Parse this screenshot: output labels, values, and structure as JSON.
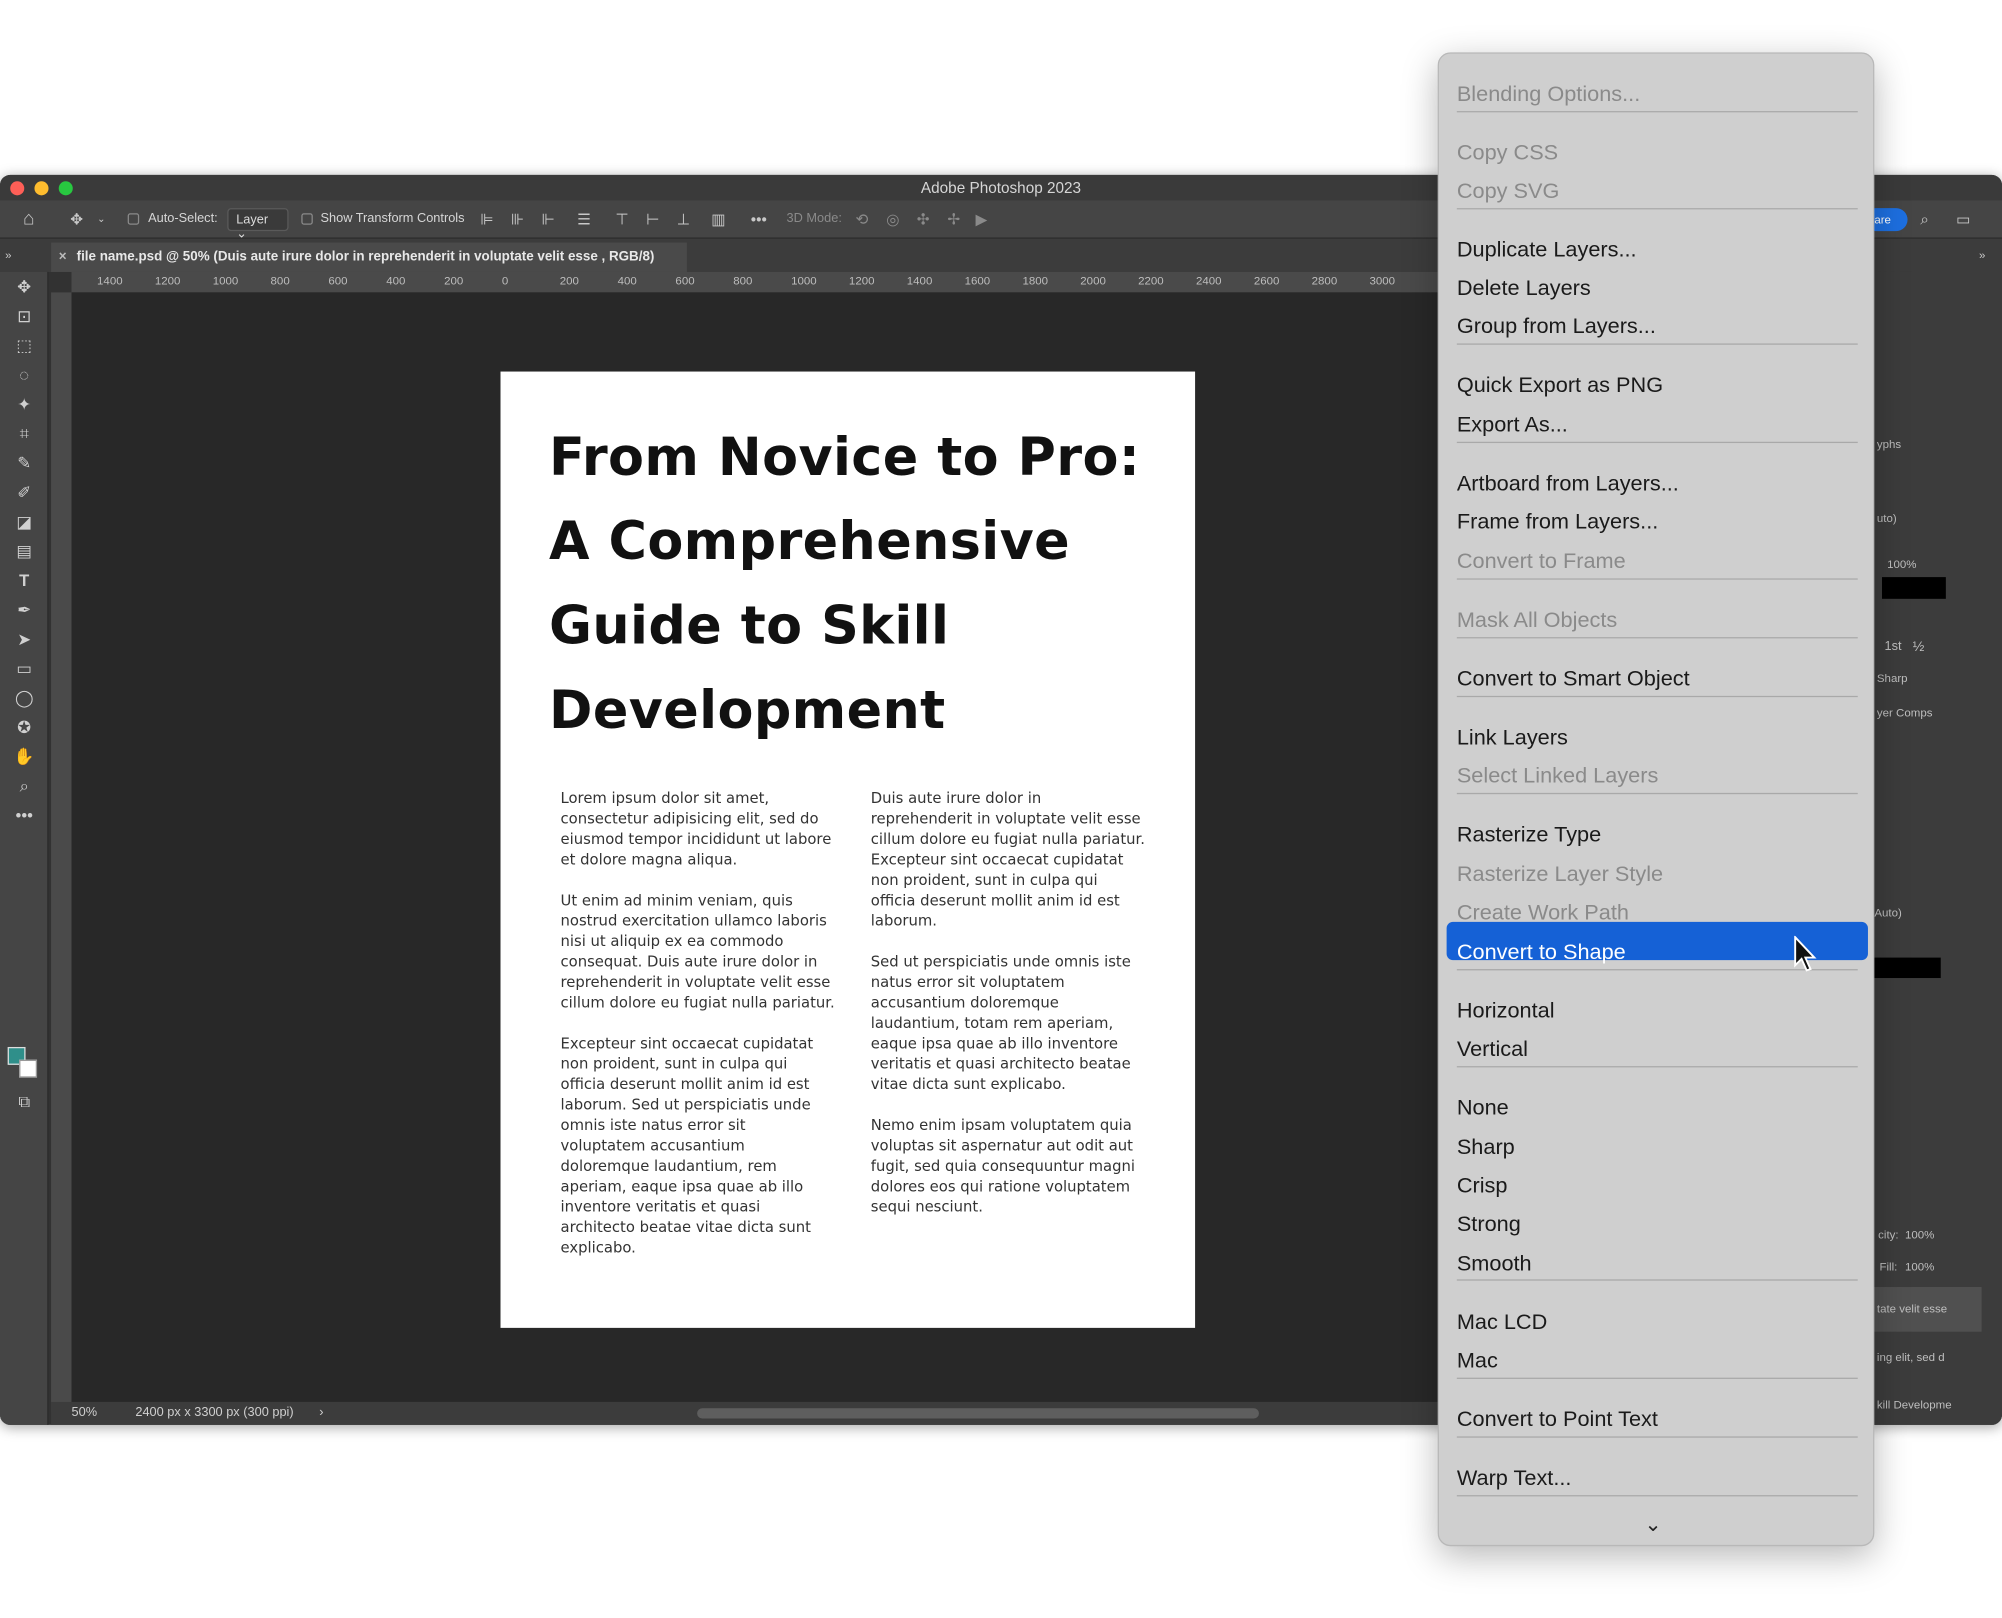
{
  "window": {
    "title": "Adobe Photoshop 2023",
    "traffic_colors": [
      "#fe5f57",
      "#febc2e",
      "#28c840"
    ]
  },
  "options_bar": {
    "auto_select_label": "Auto-Select:",
    "auto_select_value": "Layer",
    "show_transform_label": "Show Transform Controls",
    "mode_label": "3D Mode:",
    "share_label": "are"
  },
  "document_tab": {
    "title": "file name.psd @ 50% (Duis aute irure dolor in reprehenderit in voluptate velit esse , RGB/8)"
  },
  "ruler": {
    "ticks": [
      "1400",
      "1200",
      "1000",
      "800",
      "600",
      "400",
      "200",
      "0",
      "200",
      "400",
      "600",
      "800",
      "1000",
      "1200",
      "1400",
      "1600",
      "1800",
      "2000",
      "2200",
      "2400",
      "2600",
      "2800",
      "3000"
    ]
  },
  "status_bar": {
    "zoom": "50%",
    "dimensions": "2400 px x 3300 px (300 ppi)"
  },
  "document": {
    "title_lines": [
      "From Novice to Pro:",
      "A Comprehensive",
      "Guide to Skill",
      "Development"
    ],
    "left_paragraphs": [
      "Lorem ipsum dolor sit amet, consectetur adipisicing elit, sed do eiusmod tempor incididunt ut labore et dolore magna aliqua.",
      "Ut enim ad minim veniam, quis nostrud exercitation ullamco laboris nisi ut aliquip ex ea commodo consequat. Duis aute irure dolor in reprehenderit in voluptate velit esse cillum dolore eu fugiat nulla pariatur.",
      "Excepteur sint occaecat cupidatat non proident, sunt in culpa qui officia deserunt mollit anim id est laborum. Sed ut perspiciatis unde omnis iste natus error sit voluptatem accusantium doloremque laudantium, rem aperiam, eaque ipsa quae ab illo inventore veritatis et quasi architecto beatae vitae dicta sunt explicabo."
    ],
    "right_paragraphs": [
      "Duis aute irure dolor in reprehenderit in voluptate velit esse cillum dolore eu fugiat nulla pariatur. Excepteur sint occaecat cupidatat non proident, sunt in culpa qui officia deserunt mollit anim id est laborum.",
      "Sed ut perspiciatis unde omnis iste natus error sit voluptatem accusantium doloremque laudantium, totam rem aperiam, eaque ipsa quae ab illo inventore veritatis et quasi architecto beatae vitae dicta sunt explicabo.",
      "Nemo enim ipsam voluptatem quia voluptas sit aspernatur aut odit aut fugit, sed quia consequuntur magni dolores eos qui ratione voluptatem sequi nesciunt."
    ]
  },
  "right_panel": {
    "glyphs_tab": "yphs",
    "auto_1": "uto)",
    "scale_value": "100%",
    "antialias": "Sharp",
    "comps_tab": "yer Comps",
    "auto_2": "Auto)",
    "opacity_label": "city:",
    "opacity_value": "100%",
    "fill_label": "Fill:",
    "fill_value": "100%",
    "layer_1": "tate velit esse",
    "layer_2": "ing elit, sed d",
    "layer_3": "kill  Developme",
    "superscript": "1st",
    "fraction": "½"
  },
  "context_menu": {
    "items": [
      {
        "label": "Blending Options...",
        "disabled": true
      },
      {
        "label": "Copy CSS",
        "disabled": true
      },
      {
        "label": "Copy SVG",
        "disabled": true
      },
      {
        "label": "Duplicate Layers...",
        "disabled": false
      },
      {
        "label": "Delete Layers",
        "disabled": false
      },
      {
        "label": "Group from Layers...",
        "disabled": false
      },
      {
        "label": "Quick Export as PNG",
        "disabled": false
      },
      {
        "label": "Export As...",
        "disabled": false
      },
      {
        "label": "Artboard from Layers...",
        "disabled": false
      },
      {
        "label": "Frame from Layers...",
        "disabled": false
      },
      {
        "label": "Convert to Frame",
        "disabled": true
      },
      {
        "label": "Mask All Objects",
        "disabled": true
      },
      {
        "label": "Convert to Smart Object",
        "disabled": false
      },
      {
        "label": "Link Layers",
        "disabled": false
      },
      {
        "label": "Select Linked Layers",
        "disabled": true
      },
      {
        "label": "Rasterize Type",
        "disabled": false
      },
      {
        "label": "Rasterize Layer Style",
        "disabled": true
      },
      {
        "label": "Create Work Path",
        "disabled": true
      },
      {
        "label": "Convert to Shape",
        "disabled": false,
        "selected": true
      },
      {
        "label": "Horizontal",
        "disabled": false
      },
      {
        "label": "Vertical",
        "disabled": false
      },
      {
        "label": "None",
        "disabled": false
      },
      {
        "label": "Sharp",
        "disabled": false
      },
      {
        "label": "Crisp",
        "disabled": false
      },
      {
        "label": "Strong",
        "disabled": false
      },
      {
        "label": "Smooth",
        "disabled": false
      },
      {
        "label": "Mac LCD",
        "disabled": false
      },
      {
        "label": "Mac",
        "disabled": false
      },
      {
        "label": "Convert to Point Text",
        "disabled": false
      },
      {
        "label": "Warp Text...",
        "disabled": false
      }
    ],
    "more_icon": "chevron-down-icon",
    "highlight_color": "#1561d6"
  },
  "colors": {
    "foreground": "#2f8f8a",
    "background": "#ffffff"
  }
}
